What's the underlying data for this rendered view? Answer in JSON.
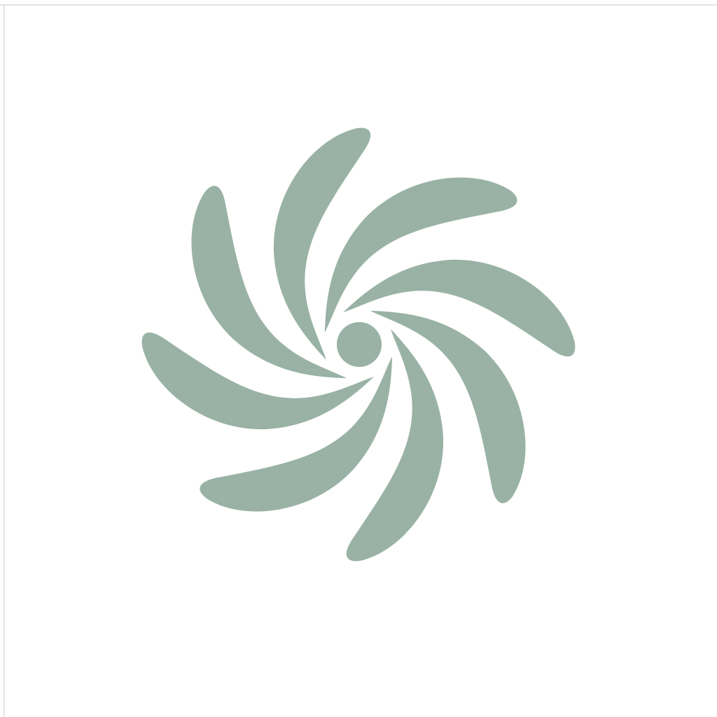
{
  "canvas": {
    "background": "#ffffff",
    "frame_color": "#e4e4e4"
  },
  "graphic": {
    "icon": "pinwheel-swirl-icon",
    "fill": "#99b2a5",
    "petal_count": 8
  }
}
